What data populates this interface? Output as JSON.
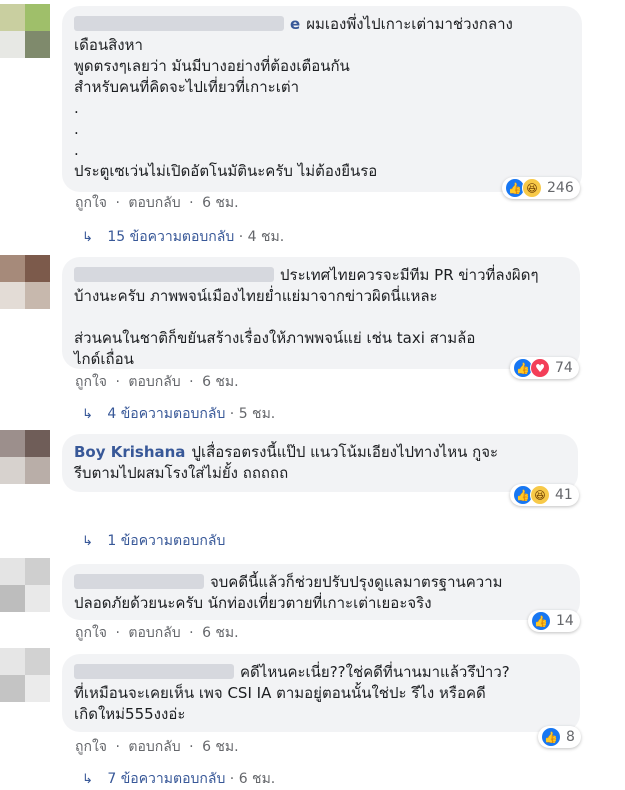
{
  "actions": {
    "like": "ถูกใจ",
    "reply": "ตอบกลับ",
    "dot": "·"
  },
  "comments": [
    {
      "name_fragment": "e",
      "body": "ผมเองพึ่งไปเกาะเต่ามาช่วงกลาง\nเดือนสิงหา\nพูดตรงๆเลยว่า มันมีบางอย่างที่ต้องเตือนกัน\nสำหรับคนที่คิดจะไปเที่ยวที่เกาะเต่า\n.\n.\n.\nประตูเซเว่นไม่เปิดอัตโนมัตินะครับ ไม่ต้องยืนรอ",
      "reactions": [
        "like",
        "haha"
      ],
      "reaction_count": "246",
      "time": "6 ชม.",
      "replies": {
        "label": "15 ข้อความตอบกลับ",
        "time": "4 ชม."
      }
    },
    {
      "name_fragment": "",
      "body": "ประเทศไทยควรจะมีทีม PR ข่าวที่ลงผิดๆ\nบ้างนะครับ ภาพพจน์เมืองไทยย่ำแย่มาจากข่าวผิดนี่แหละ\n\nส่วนคนในชาติก็ขยันสร้างเรื่องให้ภาพพจน์แย่ เช่น taxi สามล้อ\nไกด์เถื่อน",
      "reactions": [
        "like",
        "love"
      ],
      "reaction_count": "74",
      "time": "6 ชม.",
      "replies": {
        "label": "4 ข้อความตอบกลับ",
        "time": "5 ชม."
      }
    },
    {
      "name_fragment": "Boy Krishana",
      "body": "ปูเสื่อรอตรงนี้แป๊ป แนวโน้มเอียงไปทางไหน กูจะ\nรีบตามไปผสมโรงใส่ไม่ยั้ง ถถถถถ",
      "reactions": [
        "like",
        "haha"
      ],
      "reaction_count": "41",
      "time": "",
      "replies": {
        "label": "1 ข้อความตอบกลับ",
        "time": ""
      }
    },
    {
      "name_fragment": "",
      "body": "จบคดีนี้แล้วก็ช่วยปรับปรุงดูแลมาตรฐานความ\nปลอดภัยด้วยนะครับ นักท่องเที่ยวตายที่เกาะเต่าเยอะจริง",
      "reactions": [
        "like"
      ],
      "reaction_count": "14",
      "time": "6 ชม.",
      "replies": null
    },
    {
      "name_fragment": "",
      "body": "คดีไหนคะเนี่ย??ใช่คดีที่นานมาแล้วรึป่าว?\nที่เหมือนจะเคยเห็น เพจ CSI IA ตามอยู่ตอนนั้นใช่ปะ รึไง หรือคดี\nเกิดใหม่555งงอ่ะ",
      "reactions": [
        "like"
      ],
      "reaction_count": "8",
      "time": "6 ชม.",
      "replies": {
        "label": "7 ข้อความตอบกลับ",
        "time": "6 ชม."
      }
    }
  ],
  "colors": {
    "like": "#1877f2",
    "love": "#f33e58",
    "haha": "#f7c948",
    "link": "#385898",
    "bubble": "#f2f3f5"
  }
}
